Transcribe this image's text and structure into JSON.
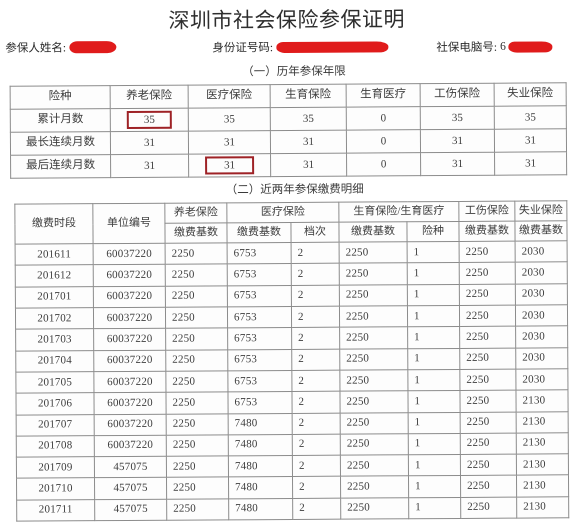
{
  "document": {
    "title": "深圳市社会保险参保证明",
    "identity": {
      "name_label": "参保人姓名:",
      "name_value": "",
      "idcard_label": "身份证号码:",
      "idcard_value": "",
      "sinumber_label": "社保电脑号:",
      "sinumber_value": "6"
    },
    "section_one_caption": "（一）历年参保年限",
    "section_two_caption": "（二）近两年参保缴费明细"
  },
  "years_table": {
    "header": [
      "险种",
      "养老保险",
      "医疗保险",
      "生育保险",
      "生育医疗",
      "工伤保险",
      "失业保险"
    ],
    "rows": [
      {
        "label": "累计月数",
        "values": [
          "35",
          "35",
          "35",
          "0",
          "35",
          "35"
        ]
      },
      {
        "label": "最长连续月数",
        "values": [
          "31",
          "31",
          "31",
          "0",
          "31",
          "31"
        ]
      },
      {
        "label": "最后连续月数",
        "values": [
          "31",
          "31",
          "31",
          "0",
          "31",
          "31"
        ]
      }
    ],
    "highlight_color": "#9e2226",
    "highlights": [
      {
        "row": 0,
        "col": 0,
        "value": "35"
      },
      {
        "row": 2,
        "col": 1,
        "value": "31"
      }
    ]
  },
  "detail_table": {
    "header_top": [
      "缴费时段",
      "单位编号",
      "养老保险",
      "医疗保险",
      "生育保险/生育医疗",
      "工伤保险",
      "失业保险"
    ],
    "header_sub": [
      "缴费基数",
      "缴费基数",
      "档次",
      "缴费基数",
      "险种",
      "缴费基数",
      "缴费基数"
    ],
    "rows": [
      {
        "period": "201611",
        "unit": "60037220",
        "pension_base": "2250",
        "medical_base": "6753",
        "medical_tier": "2",
        "maternity_base": "2250",
        "maternity_type": "1",
        "injury_base": "2250",
        "unemployment_base": "2030"
      },
      {
        "period": "201612",
        "unit": "60037220",
        "pension_base": "2250",
        "medical_base": "6753",
        "medical_tier": "2",
        "maternity_base": "2250",
        "maternity_type": "1",
        "injury_base": "2250",
        "unemployment_base": "2030"
      },
      {
        "period": "201701",
        "unit": "60037220",
        "pension_base": "2250",
        "medical_base": "6753",
        "medical_tier": "2",
        "maternity_base": "2250",
        "maternity_type": "1",
        "injury_base": "2250",
        "unemployment_base": "2030"
      },
      {
        "period": "201702",
        "unit": "60037220",
        "pension_base": "2250",
        "medical_base": "6753",
        "medical_tier": "2",
        "maternity_base": "2250",
        "maternity_type": "1",
        "injury_base": "2250",
        "unemployment_base": "2030"
      },
      {
        "period": "201703",
        "unit": "60037220",
        "pension_base": "2250",
        "medical_base": "6753",
        "medical_tier": "2",
        "maternity_base": "2250",
        "maternity_type": "1",
        "injury_base": "2250",
        "unemployment_base": "2030"
      },
      {
        "period": "201704",
        "unit": "60037220",
        "pension_base": "2250",
        "medical_base": "6753",
        "medical_tier": "2",
        "maternity_base": "2250",
        "maternity_type": "1",
        "injury_base": "2250",
        "unemployment_base": "2030"
      },
      {
        "period": "201705",
        "unit": "60037220",
        "pension_base": "2250",
        "medical_base": "6753",
        "medical_tier": "2",
        "maternity_base": "2250",
        "maternity_type": "1",
        "injury_base": "2250",
        "unemployment_base": "2030"
      },
      {
        "period": "201706",
        "unit": "60037220",
        "pension_base": "2250",
        "medical_base": "6753",
        "medical_tier": "2",
        "maternity_base": "2250",
        "maternity_type": "1",
        "injury_base": "2250",
        "unemployment_base": "2130"
      },
      {
        "period": "201707",
        "unit": "60037220",
        "pension_base": "2250",
        "medical_base": "7480",
        "medical_tier": "2",
        "maternity_base": "2250",
        "maternity_type": "1",
        "injury_base": "2250",
        "unemployment_base": "2130"
      },
      {
        "period": "201708",
        "unit": "60037220",
        "pension_base": "2250",
        "medical_base": "7480",
        "medical_tier": "2",
        "maternity_base": "2250",
        "maternity_type": "1",
        "injury_base": "2250",
        "unemployment_base": "2130"
      },
      {
        "period": "201709",
        "unit": "457075",
        "pension_base": "2250",
        "medical_base": "7480",
        "medical_tier": "2",
        "maternity_base": "2250",
        "maternity_type": "1",
        "injury_base": "2250",
        "unemployment_base": "2130"
      },
      {
        "period": "201710",
        "unit": "457075",
        "pension_base": "2250",
        "medical_base": "7480",
        "medical_tier": "2",
        "maternity_base": "2250",
        "maternity_type": "1",
        "injury_base": "2250",
        "unemployment_base": "2130"
      },
      {
        "period": "201711",
        "unit": "457075",
        "pension_base": "2250",
        "medical_base": "7480",
        "medical_tier": "2",
        "maternity_base": "2250",
        "maternity_type": "1",
        "injury_base": "2250",
        "unemployment_base": "2130"
      }
    ]
  }
}
